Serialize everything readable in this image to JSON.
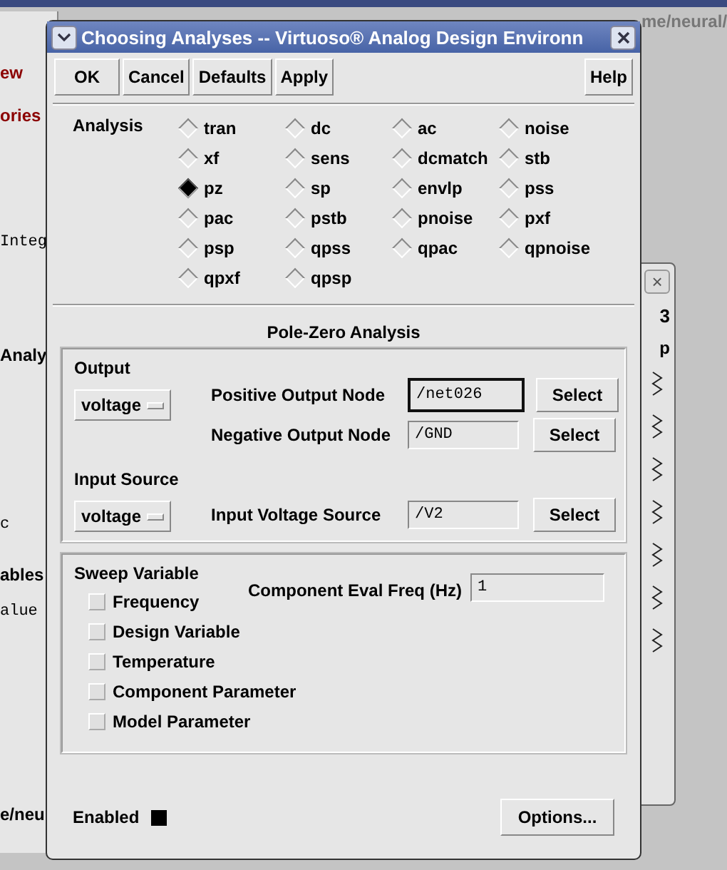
{
  "background": {
    "path_fragment": "me/neural/",
    "left_fragments": [
      {
        "text": "ew",
        "kind": "link"
      },
      {
        "text": "ories",
        "kind": "link"
      },
      {
        "text": "Integ",
        "kind": "mono"
      },
      {
        "text": "Analy",
        "kind": "bold"
      },
      {
        "text": "c",
        "kind": "mono"
      },
      {
        "text": "ables",
        "kind": "bold"
      },
      {
        "text": "alue",
        "kind": "mono"
      },
      {
        "text": "e/neu",
        "kind": "bold"
      }
    ],
    "right_panel": {
      "close": "×",
      "number": "3",
      "fragment": "p"
    }
  },
  "dialog": {
    "title": "Choosing Analyses -- Virtuoso® Analog Design Environn",
    "buttons": [
      "OK",
      "Cancel",
      "Defaults",
      "Apply"
    ],
    "help": "Help",
    "analysis_label": "Analysis",
    "analyses": [
      {
        "label": "tran",
        "selected": false
      },
      {
        "label": "dc",
        "selected": false
      },
      {
        "label": "ac",
        "selected": false
      },
      {
        "label": "noise",
        "selected": false
      },
      {
        "label": "xf",
        "selected": false
      },
      {
        "label": "sens",
        "selected": false
      },
      {
        "label": "dcmatch",
        "selected": false
      },
      {
        "label": "stb",
        "selected": false
      },
      {
        "label": "pz",
        "selected": true
      },
      {
        "label": "sp",
        "selected": false
      },
      {
        "label": "envlp",
        "selected": false
      },
      {
        "label": "pss",
        "selected": false
      },
      {
        "label": "pac",
        "selected": false
      },
      {
        "label": "pstb",
        "selected": false
      },
      {
        "label": "pnoise",
        "selected": false
      },
      {
        "label": "pxf",
        "selected": false
      },
      {
        "label": "psp",
        "selected": false
      },
      {
        "label": "qpss",
        "selected": false
      },
      {
        "label": "qpac",
        "selected": false
      },
      {
        "label": "qpnoise",
        "selected": false
      },
      {
        "label": "qpxf",
        "selected": false
      },
      {
        "label": "qpsp",
        "selected": false
      }
    ],
    "section_title": "Pole-Zero Analysis",
    "output": {
      "label": "Output",
      "type": "voltage",
      "nodes": [
        {
          "label": "Positive Output Node",
          "value": "/net026",
          "focused": true,
          "button": "Select"
        },
        {
          "label": "Negative Output Node",
          "value": "/GND",
          "focused": false,
          "button": "Select"
        }
      ]
    },
    "input_source": {
      "label": "Input Source",
      "type": "voltage",
      "field": {
        "label": "Input Voltage Source",
        "value": "/V2",
        "focused": false,
        "button": "Select"
      }
    },
    "sweep": {
      "label": "Sweep Variable",
      "options": [
        {
          "label": "Frequency",
          "checked": false
        },
        {
          "label": "Design Variable",
          "checked": false
        },
        {
          "label": "Temperature",
          "checked": false
        },
        {
          "label": "Component Parameter",
          "checked": false
        },
        {
          "label": "Model Parameter",
          "checked": false
        }
      ]
    },
    "eval_freq": {
      "label": "Component Eval Freq (Hz)",
      "value": "1"
    },
    "enabled": {
      "label": "Enabled",
      "on": true
    },
    "options_button": "Options..."
  }
}
